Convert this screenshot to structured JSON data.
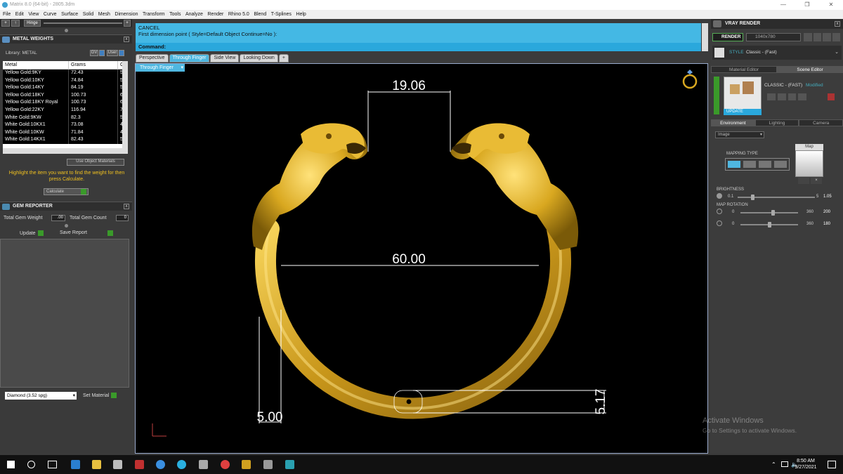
{
  "window": {
    "title": "Matrix 8.0 (64-bit) - 2805.3dm"
  },
  "menu": [
    "File",
    "Edit",
    "View",
    "Curve",
    "Surface",
    "Solid",
    "Mesh",
    "Dimension",
    "Transform",
    "Tools",
    "Analyze",
    "Render",
    "Rhino 5.0",
    "Blend",
    "T-Splines",
    "Help"
  ],
  "left_toolstrip": {
    "hinge_label": "Hinge"
  },
  "metal_weights": {
    "title": "METAL WEIGHTS",
    "library_label": "Library:  METAL",
    "gv_label": "GV",
    "user_label": "User",
    "columns": [
      "Metal",
      "Grams",
      "C"
    ],
    "rows": [
      {
        "metal": "Yellow Gold:9KY",
        "grams": "72.43",
        "c": "5"
      },
      {
        "metal": "Yellow Gold:10KY",
        "grams": "74.84",
        "c": "5"
      },
      {
        "metal": "Yellow Gold:14KY",
        "grams": "84.19",
        "c": "5"
      },
      {
        "metal": "Yellow Gold:18KY",
        "grams": "100.73",
        "c": "6"
      },
      {
        "metal": "Yellow Gold:18KY Royal",
        "grams": "100.73",
        "c": "6"
      },
      {
        "metal": "Yellow Gold:22KY",
        "grams": "116.94",
        "c": "7"
      },
      {
        "metal": "White Gold:9KW",
        "grams": "82.3",
        "c": "5"
      },
      {
        "metal": "White Gold:10KX1",
        "grams": "73.08",
        "c": "4"
      },
      {
        "metal": "White Gold:10KW",
        "grams": "71.84",
        "c": "4"
      },
      {
        "metal": "White Gold:14KX1",
        "grams": "82.43",
        "c": "5"
      }
    ],
    "use_object_materials": "Use Object Materials",
    "hint": "Highlight the item you want to find the weight for then press Calculate.",
    "calculate_label": "Calculate"
  },
  "gem_reporter": {
    "title": "GEM REPORTER",
    "total_weight_label": "Total Gem Weight",
    "total_weight_value": ".00",
    "total_count_label": "Total Gem Count",
    "total_count_value": "0",
    "update_label": "Update",
    "save_report_label": "Save Report",
    "material_value": "Diamond     (3.52 spg)",
    "set_material_label": "Set Material"
  },
  "command": {
    "line1": "CANCEL",
    "line2": "First dimension point ( Style=Default  Object  Continue=No ):",
    "prompt_label": "Command:"
  },
  "viewport_tabs": [
    "Perspective",
    "Through Finger",
    "Side View",
    "Looking Down",
    "+"
  ],
  "active_viewport_label": "Through Finger",
  "dimensions": {
    "top_gap": "19.06",
    "inner_diameter": "60.00",
    "band_width": "5.00",
    "band_height": "5.17"
  },
  "vray": {
    "title": "VRAY RENDER",
    "render_label": "RENDER",
    "resolution": "1040x780",
    "style_label": "STYLE",
    "style_value": "Classic - (Fast)",
    "tabs": [
      "Material Editor",
      "Scene Editor"
    ],
    "scene_name": "CLASSIC - (FAST)",
    "modified": "Modified",
    "update_label": "UPDATE",
    "env_tabs": [
      "Environment",
      "Lighting",
      "Camera"
    ],
    "env_type": "Image",
    "mapping_type_label": "MAPPING TYPE",
    "map_label": "Map",
    "brightness_label": "BRIGHTNESS",
    "brightness_min": "0.1",
    "brightness_max": "5",
    "brightness_value": "1.05",
    "map_rotation_label": "MAP ROTATION",
    "rot1_min": "0",
    "rot1_max": "360",
    "rot1_value": "200",
    "rot2_min": "0",
    "rot2_max": "360",
    "rot2_value": "180"
  },
  "watermark": {
    "line1": "Activate Windows",
    "line2": "Go to Settings to activate Windows."
  },
  "taskbar": {
    "time": "8:50 AM",
    "date": "9/27/2021"
  },
  "colors": {
    "accent_blue": "#44b8e4",
    "gold": "#d9a820",
    "viewport_bg": "#000000"
  }
}
